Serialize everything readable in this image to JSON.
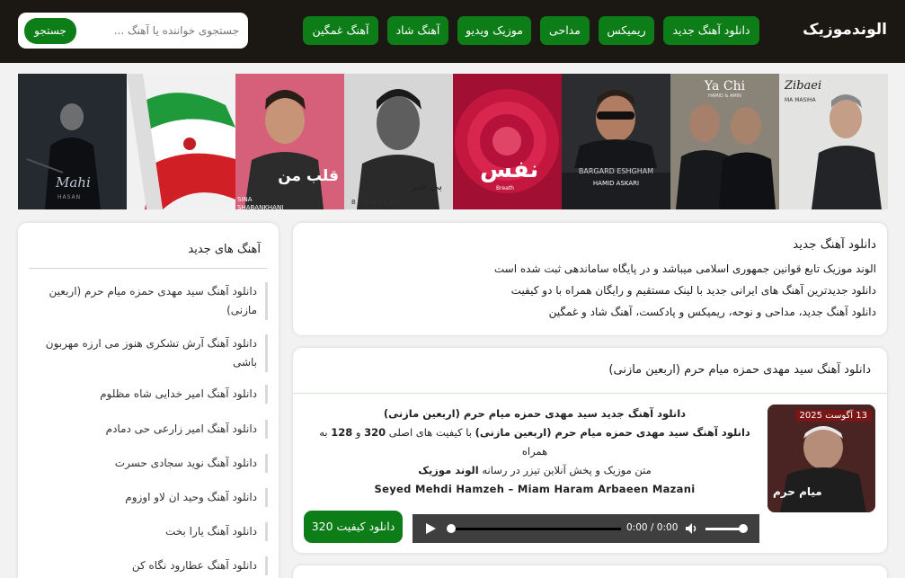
{
  "header": {
    "logo": "الوندموزیک",
    "nav": [
      "دانلود آهنگ جدید",
      "ریمیکس",
      "مداحی",
      "موزیک ویدیو",
      "آهنگ شاد",
      "آهنگ غمگین"
    ],
    "search_placeholder": "جستجوی خواننده یا آهنگ ...",
    "search_button": "جستجو"
  },
  "covers": [
    {
      "caption": "Zibaei",
      "sub": "MA MASIHA"
    },
    {
      "caption": "Ya Chi",
      "sub": "HAMID & AMIN"
    },
    {
      "caption": "BARGARD ESHGHAM",
      "sub": "HAMID ASKARI"
    },
    {
      "caption": "نفس",
      "sub": "Breath"
    },
    {
      "caption": "بی خبر",
      "sub": "BI KHABAR"
    },
    {
      "caption": "قلب من",
      "sub": "SINA SHABANKHANI"
    },
    {
      "caption": "",
      "sub": ""
    },
    {
      "caption": "Mahi",
      "sub": "HASAN"
    }
  ],
  "intro": {
    "title": "دانلود آهنگ جدید",
    "lines": [
      "الوند موزیک تابع قوانین جمهوری اسلامی میباشد و در پایگاه ساماندهی ثبت شده است",
      "دانلود جدیدترین آهنگ های ایرانی جدید با لینک مستقیم و رایگان همراه با دو کیفیت",
      "دانلود آهنگ جدید، مداحی و نوحه، ریمیکس و پادکست، آهنگ شاد و غمگین"
    ]
  },
  "post": {
    "title": "دانلود آهنگ سید مهدی حمزه میام حرم (اربعین مازنی)",
    "date": "13 آگوست 2025",
    "heading": "دانلود آهنگ جدید سید مهدی حمزه میام حرم (اربعین مازنی)",
    "line2_bold": "دانلود آهنگ سید مهدی حمزه میام حرم (اربعین مازنی)",
    "line2_rest": " با کیفیت های اصلی ",
    "q1": "320",
    "and": " و ",
    "q2": "128",
    "line2_end": " به همراه",
    "line3_pre": "متن موزیک و پخش آنلاین تیزر در رسانه ",
    "line3_bold": "الوند موزیک",
    "english": "Seyed Mehdi Hamzeh – Miam Haram Arbaeen Mazani",
    "thumb_text": "میام حرم",
    "player_time": "0:00 / 0:00",
    "download_label": "دانلود کیفیت 320"
  },
  "sidebar": {
    "title": "آهنگ های جدید",
    "items": [
      "دانلود آهنگ سید مهدی حمزه میام حرم (اربعین مازنی)",
      "دانلود آهنگ آرش تشکری هنوز می ارزه مهربون باشی",
      "دانلود آهنگ امیر خدایی شاه مظلوم",
      "دانلود آهنگ امیر زارعی حی دمادم",
      "دانلود آهنگ نوید سجادی حسرت",
      "دانلود آهنگ وحید ان لاو اوزوم",
      "دانلود آهنگ یارا بخت",
      "دانلود آهنگ عطارود نگاه کن"
    ]
  },
  "colors": {
    "header_bg": "#1b1712",
    "accent_green": "#0d7d18",
    "page_bg": "#f2f2f2"
  }
}
